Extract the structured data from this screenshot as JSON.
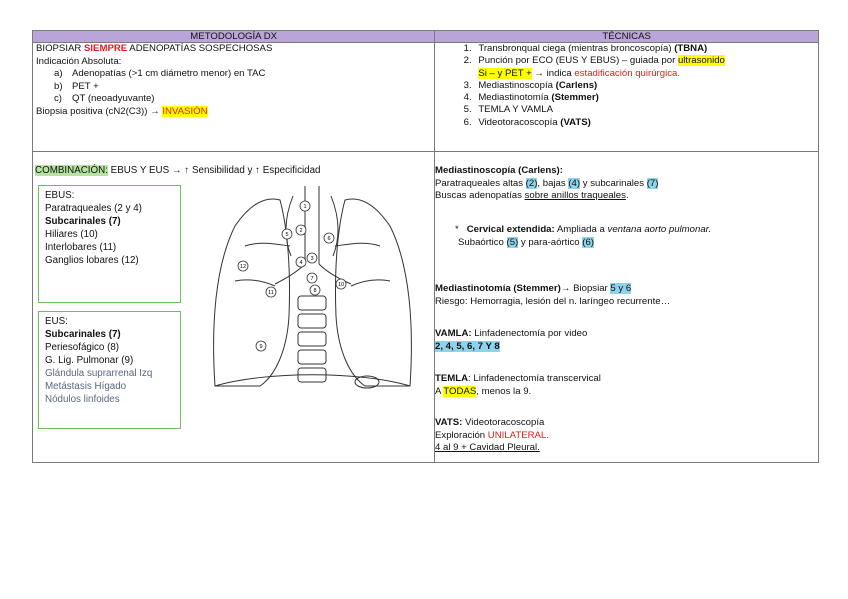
{
  "headers": {
    "left": "METODOLOGÍA DX",
    "right": "TÉCNICAS"
  },
  "left_top": {
    "line1_pre": "BIOPSIAR ",
    "line1_red": "SIEMPRE",
    "line1_post": " ADENOPATÍAS SOSPECHOSAS",
    "line2": "Indicación Absoluta:",
    "items": [
      {
        "marker": "a)",
        "text": "Adenopatías (>1 cm diámetro menor) en TAC"
      },
      {
        "marker": "b)",
        "text": "PET +"
      },
      {
        "marker": "c)",
        "text": "QT (neoadyuvante)"
      }
    ],
    "biopsy_pre": "Biopsia positiva (cN2(C3)) → ",
    "biopsy_hl": "INVASIÓN"
  },
  "right_top": {
    "items": [
      {
        "text": "Transbronqual ciega (mientras broncoscopía) ",
        "bold": "(TBNA)"
      },
      {
        "text": "Punción por ECO (EUS Y EBUS) – guiada por ",
        "hl": "ultrasonido"
      },
      {
        "text": "Mediastinoscopía ",
        "bold": "(Carlens)"
      },
      {
        "text": "Mediastinotomía ",
        "bold": "(Stemmer)"
      },
      {
        "text": "TEMLA Y VAMLA"
      },
      {
        "text": "Videotoracoscopía ",
        "bold": "(VATS)"
      }
    ],
    "item2_cont_hl": "Si – y PET +",
    "item2_cont_mid": " → indica ",
    "item2_cont_red": "estadificación quirúrgica."
  },
  "combination": {
    "hl": "COMBINACIÓN:",
    "text": " EBUS Y EUS → ↑ Sensibilidad y ↑ Especificidad"
  },
  "ebus_box": {
    "title": "EBUS:",
    "items": [
      {
        "text": "Paratraqueales (2 y 4)",
        "bold": false
      },
      {
        "text": "Subcarinales (7)",
        "bold": true
      },
      {
        "text": "Hiliares (10)",
        "bold": false
      },
      {
        "text": "Interlobares (11)",
        "bold": false
      },
      {
        "text": "Ganglios lobares (12)",
        "bold": false
      }
    ]
  },
  "eus_box": {
    "title": "EUS:",
    "items": [
      {
        "text": "Subcarinales (7)",
        "style": "bold"
      },
      {
        "text": "Periesofágico (8)",
        "style": "normal"
      },
      {
        "text": "G. Lig. Pulmonar (9)",
        "style": "normal"
      },
      {
        "text": "Glándula suprarrenal Izq",
        "style": "gray"
      },
      {
        "text": "Metástasis Hígado",
        "style": "gray"
      },
      {
        "text": "Nódulos linfoides",
        "style": "gray"
      }
    ]
  },
  "diagram": {
    "node_labels": [
      "1",
      "2",
      "3",
      "4",
      "5",
      "6",
      "7",
      "8",
      "9",
      "10",
      "11",
      "12"
    ]
  },
  "mediastinoscopia": {
    "title": "Mediastinoscopía (Carlens):",
    "l1_a": "Paratraqueales altas ",
    "l1_h1": "(2)",
    "l1_b": ", bajas ",
    "l1_h2": "(4)",
    "l1_c": " y subcarinales ",
    "l1_h3": "(7)",
    "l2_a": "Buscas adenopatías ",
    "l2_u": "sobre anillos traqueales",
    "l2_b": ".",
    "bullet": "*",
    "ext_bold": "Cervical extendida:",
    "ext_a": " Ampliada a ",
    "ext_it": "ventana aorto pulmonar.",
    "sub_a": "Subaórtico ",
    "sub_h1": "(5)",
    "sub_b": " y para-aórtico ",
    "sub_h2": "(6)"
  },
  "mediastinotomia": {
    "bold": "Mediastinotomía (Stemmer)",
    "arrow": "→ Biopsiar ",
    "hl": "5 y 6",
    "riesgo": "Riesgo: Hemorragia, lesión del n. laríngeo recurrente…"
  },
  "vamla": {
    "bold": "VAMLA:",
    "text": " Linfadenectomía por video",
    "hl": "2, 4, 5, 6, 7 Y 8"
  },
  "temla": {
    "bold": "TEMLA",
    "text": ": Linfadenectomía transcervical",
    "l2_a": "A ",
    "l2_hl": "TODAS",
    "l2_b": ", menos la 9."
  },
  "vats": {
    "bold": "VATS:",
    "text": " Videotoracoscopía",
    "l2_a": "Exploración ",
    "l2_red": "UNILATERAL.",
    "l3": "4 al 9 + Cavidad Pleural."
  }
}
